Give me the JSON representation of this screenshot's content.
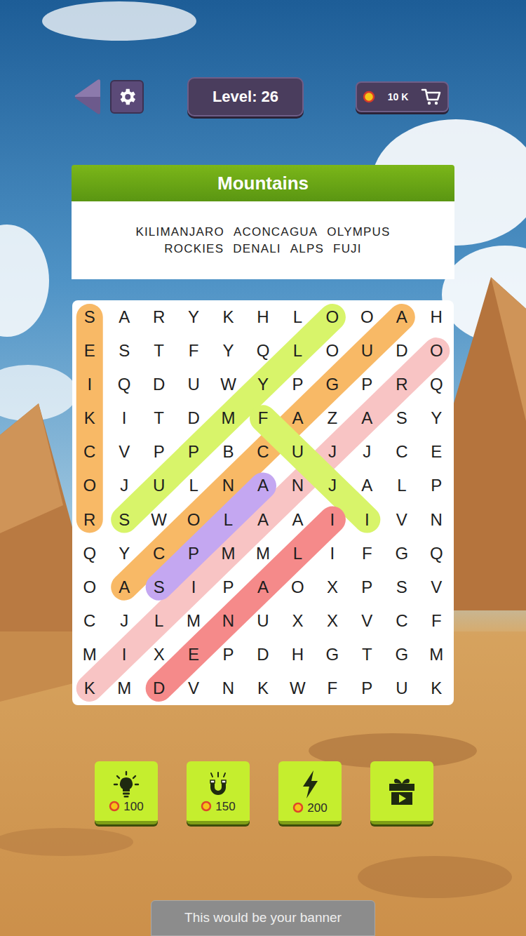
{
  "top_bar": {
    "level": "Level: 26",
    "coins": "10 K"
  },
  "puzzle": {
    "title": "Mountains",
    "word_lines": [
      [
        "KILIMANJARO",
        "ACONCAGUA",
        "OLYMPUS"
      ],
      [
        "ROCKIES",
        "DENALI",
        "ALPS",
        "FUJI"
      ]
    ]
  },
  "grid": {
    "rows": [
      [
        "S",
        "A",
        "R",
        "Y",
        "K",
        "H",
        "L",
        "O",
        "O",
        "A",
        "H"
      ],
      [
        "E",
        "S",
        "T",
        "F",
        "Y",
        "Q",
        "L",
        "O",
        "U",
        "D",
        "O"
      ],
      [
        "I",
        "Q",
        "D",
        "U",
        "W",
        "Y",
        "P",
        "G",
        "P",
        "R",
        "Q"
      ],
      [
        "K",
        "I",
        "T",
        "D",
        "M",
        "F",
        "A",
        "Z",
        "A",
        "S",
        "Y"
      ],
      [
        "C",
        "V",
        "P",
        "P",
        "B",
        "C",
        "U",
        "J",
        "J",
        "C",
        "E"
      ],
      [
        "O",
        "J",
        "U",
        "L",
        "N",
        "A",
        "N",
        "J",
        "A",
        "L",
        "P"
      ],
      [
        "R",
        "S",
        "W",
        "O",
        "L",
        "A",
        "A",
        "I",
        "I",
        "V",
        "N"
      ],
      [
        "Q",
        "Y",
        "C",
        "P",
        "M",
        "M",
        "L",
        "I",
        "F",
        "G",
        "Q"
      ],
      [
        "O",
        "A",
        "S",
        "I",
        "P",
        "A",
        "O",
        "X",
        "P",
        "S",
        "V"
      ],
      [
        "C",
        "J",
        "L",
        "M",
        "N",
        "U",
        "X",
        "X",
        "V",
        "C",
        "F"
      ],
      [
        "M",
        "I",
        "X",
        "E",
        "P",
        "D",
        "H",
        "G",
        "T",
        "G",
        "M"
      ],
      [
        "K",
        "M",
        "D",
        "V",
        "N",
        "K",
        "W",
        "F",
        "P",
        "U",
        "K"
      ]
    ],
    "highlights": [
      {
        "color": "#f8b966",
        "from": [
          0,
          0
        ],
        "to": [
          6,
          0
        ]
      },
      {
        "color": "#f8b966",
        "from": [
          0,
          9
        ],
        "to": [
          8,
          1
        ]
      },
      {
        "color": "#f8c4c4",
        "from": [
          1,
          10
        ],
        "to": [
          11,
          0
        ]
      },
      {
        "color": "#d8f46a",
        "from": [
          0,
          7
        ],
        "to": [
          6,
          1
        ]
      },
      {
        "color": "#c4a7f1",
        "from": [
          5,
          5
        ],
        "to": [
          8,
          2
        ]
      },
      {
        "color": "#d8f46a",
        "from": [
          3,
          5
        ],
        "to": [
          6,
          8
        ]
      },
      {
        "color": "#f58a8a",
        "from": [
          6,
          7
        ],
        "to": [
          11,
          2
        ]
      }
    ]
  },
  "powerups": [
    {
      "kind": "hint",
      "price": "100"
    },
    {
      "kind": "magnet",
      "price": "150"
    },
    {
      "kind": "lightning",
      "price": "200"
    },
    {
      "kind": "video"
    }
  ],
  "banner": "This would be your banner"
}
